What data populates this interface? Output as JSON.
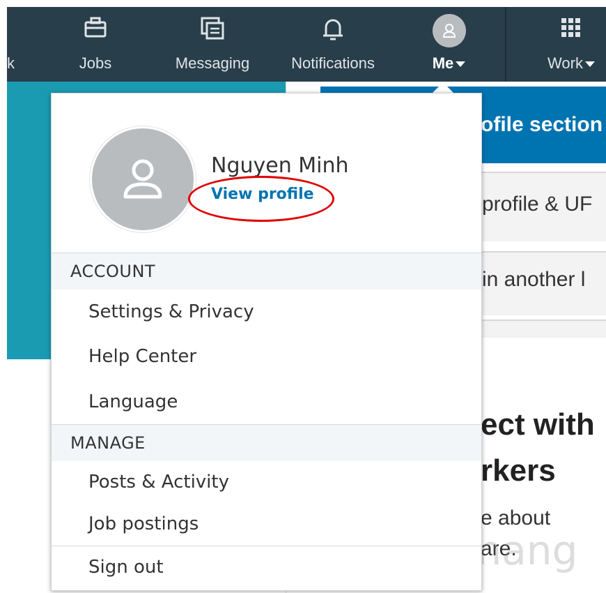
{
  "nav": {
    "partial_label": "k",
    "jobs_label": "Jobs",
    "messaging_label": "Messaging",
    "notifications_label": "Notifications",
    "me_label": "Me",
    "work_label": "Work"
  },
  "background": {
    "banner_text": "ofile section",
    "row1_text": "profile & UF",
    "row2_text": "in another l",
    "headline_line1": "ect with",
    "headline_line2": "rkers",
    "body_line1": "e about",
    "body_line2": "are."
  },
  "dropdown": {
    "user_name": "Nguyen Minh",
    "view_profile": "View profile",
    "account_header": "ACCOUNT",
    "account_items": [
      "Settings & Privacy",
      "Help Center",
      "Language"
    ],
    "manage_header": "MANAGE",
    "manage_items": [
      "Posts & Activity",
      "Job postings"
    ],
    "sign_out": "Sign out"
  },
  "watermark": "uantrimang",
  "colors": {
    "nav_bg": "#283e4a",
    "teal": "#1a9bb2",
    "brand_blue": "#0073b1",
    "highlight_ellipse": "#e00000"
  }
}
